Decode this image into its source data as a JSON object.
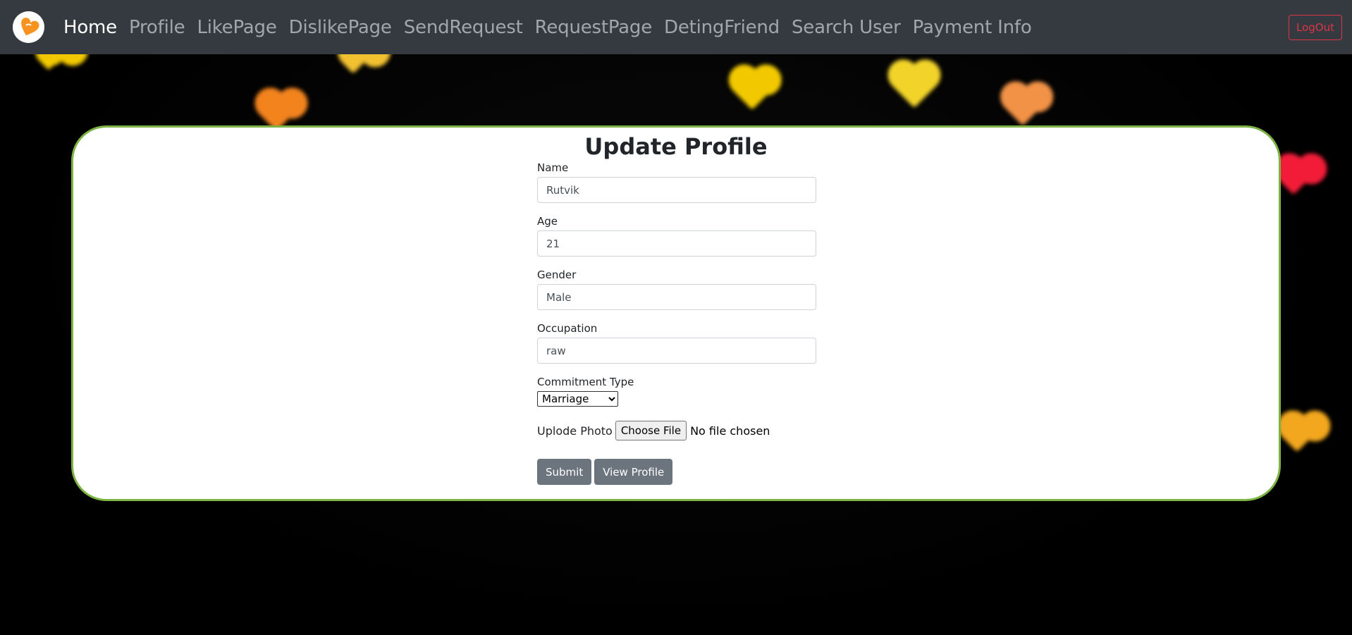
{
  "navbar": {
    "brand_icon": "heart-logo",
    "items": [
      {
        "label": "Home",
        "active": true
      },
      {
        "label": "Profile",
        "active": false
      },
      {
        "label": "LikePage",
        "active": false
      },
      {
        "label": "DislikePage",
        "active": false
      },
      {
        "label": "SendRequest",
        "active": false
      },
      {
        "label": "RequestPage",
        "active": false
      },
      {
        "label": "DetingFriend",
        "active": false
      },
      {
        "label": "Search User",
        "active": false
      },
      {
        "label": "Payment Info",
        "active": false
      }
    ],
    "logout_label": "LogOut"
  },
  "form": {
    "title": "Update Profile",
    "name": {
      "label": "Name",
      "value": "Rutvik"
    },
    "age": {
      "label": "Age",
      "value": "21"
    },
    "gender": {
      "label": "Gender",
      "value": "Male"
    },
    "occupation": {
      "label": "Occupation",
      "value": "raw"
    },
    "commitment": {
      "label": "Commitment Type",
      "selected": "Marriage"
    },
    "photo": {
      "label": "Uplode Photo",
      "button_label": "Choose File",
      "status": "No file chosen"
    },
    "submit_label": "Submit",
    "view_profile_label": "View Profile"
  },
  "colors": {
    "navbar_bg": "#343a40",
    "card_border": "#7cb342",
    "logout": "#dc3545",
    "button_bg": "#6c757d",
    "logo_heart": "#f7931e"
  }
}
